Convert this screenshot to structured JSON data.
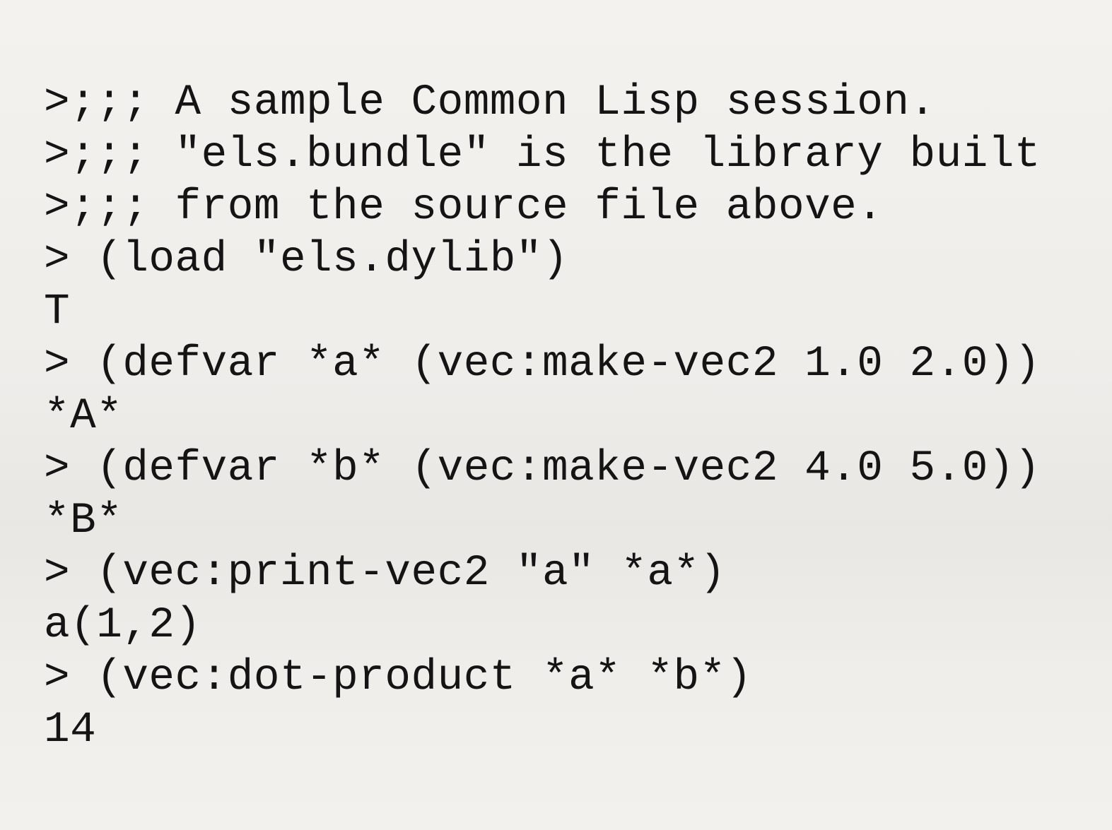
{
  "transcript": {
    "lines": [
      ">;;; A sample Common Lisp session.",
      ">;;; \"els.bundle\" is the library built",
      ">;;; from the source file above.",
      "> (load \"els.dylib\")",
      "T",
      "> (defvar *a* (vec:make-vec2 1.0 2.0))",
      "*A*",
      "> (defvar *b* (vec:make-vec2 4.0 5.0))",
      "*B*",
      "> (vec:print-vec2 \"a\" *a*)",
      "a(1,2)",
      "> (vec:dot-product *a* *b*)",
      "14"
    ]
  }
}
